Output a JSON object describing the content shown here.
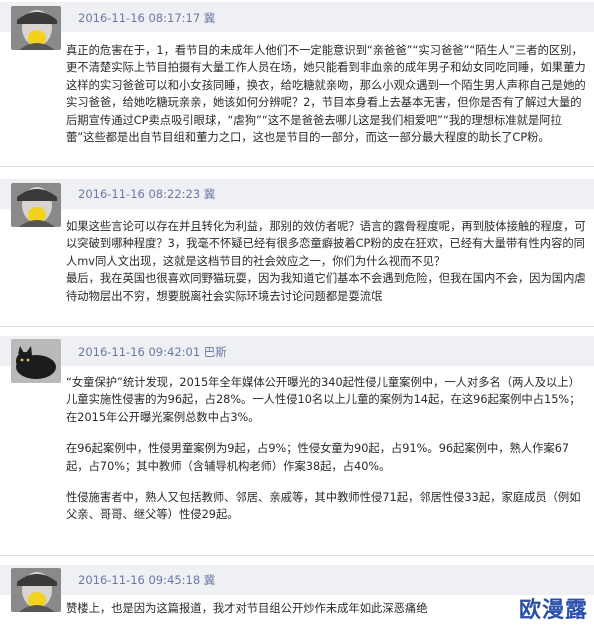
{
  "colors": {
    "accent": "#6a79a4",
    "header_bg": "#eef0f4",
    "watermark": "#2a4fa8"
  },
  "comments": [
    {
      "meta": "2016-11-16 08:17:17 冀",
      "avatar_icon": "girl-hat-avatar",
      "paragraphs": [
        "真正的危害在于，1，看节目的未成年人他们不一定能意识到“亲爸爸”“实习爸爸”“陌生人”三者的区别，更不清楚实际上节目拍摄有大量工作人员在场，她只能看到非血亲的成年男子和幼女同吃同睡，如果董力这样的实习爸爸可以和小女孩同睡，换衣，给吃糖就亲吻，那么小观众遇到一个陌生男人声称自己是她的实习爸爸，给她吃糖玩亲亲，她该如何分辨呢？2，节目本身看上去基本无害，但你是否有了解过大量的后期宣传通过CP卖点吸引眼球，“虐狗”“这不是爸爸去哪儿这是我们相爱吧”“我的理想标准就是阿拉蕾”这些都是出自节目组和董力之口，这也是节目的一部分，而这一部分最大程度的助长了CP粉。"
      ]
    },
    {
      "meta": "2016-11-16 08:22:23 冀",
      "avatar_icon": "girl-hat-avatar",
      "paragraphs": [
        "如果这些言论可以存在并且转化为利益，那别的效仿者呢？语言的露骨程度呢，再到肢体接触的程度，可以突破到哪种程度？3，我毫不怀疑已经有很多恋童癖披着CP粉的皮在狂欢，已经有大量带有性内容的同人mv同人文出现，这就是这档节目的社会效应之一，你们为什么视而不见？",
        "最后，我在英国也很喜欢同野猫玩耍，因为我知道它们基本不会遇到危险，但我在国内不会，因为国内虐待动物层出不穷，想要脱离社会实际环境去讨论问题都是耍流氓"
      ]
    },
    {
      "meta": "2016-11-16 09:42:01 巴斯",
      "avatar_icon": "black-cat-avatar",
      "paragraphs": [
        "“女童保护”统计发现，2015年全年媒体公开曝光的340起性侵儿童案例中，一人对多名（两人及以上）儿童实施性侵害的为96起，占28%。一人性侵10名以上儿童的案例为14起，在这96起案例中占15%；在2015年公开曝光案例总数中占3%。",
        "",
        "在96起案例中，性侵男童案例为9起，占9%；性侵女童为90起，占91%。96起案例中，熟人作案67起，占70%；其中教师（含辅导机构老师）作案38起，占40%。",
        "",
        "性侵施害者中，熟人又包括教师、邻居、亲戚等，其中教师性侵71起，邻居性侵33起，家庭成员（例如父亲、哥哥、继父等）性侵29起。"
      ]
    },
    {
      "meta": "2016-11-16 09:45:18 冀",
      "avatar_icon": "girl-hat-avatar",
      "paragraphs": [
        "赞楼上，也是因为这篇报道，我才对节目组公开炒作未成年如此深恶痛绝"
      ]
    }
  ],
  "watermark": "欧漫露"
}
